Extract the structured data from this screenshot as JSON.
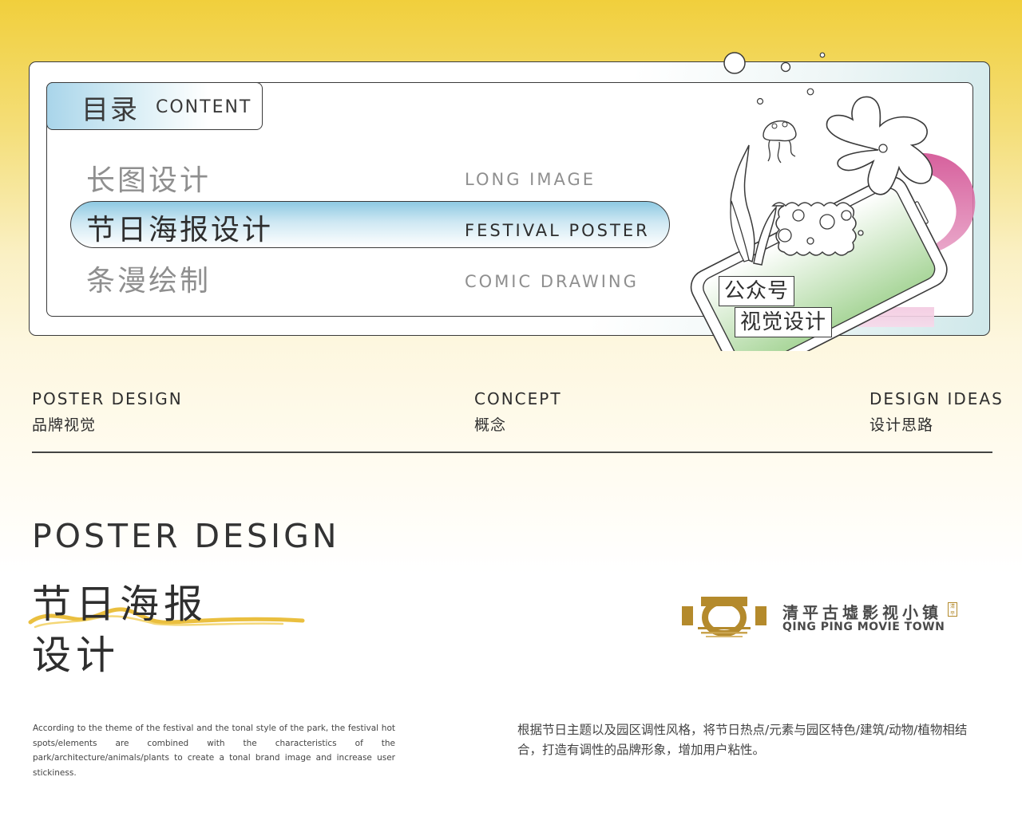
{
  "menu": {
    "tab_cn": "目录",
    "tab_en": "CONTENT",
    "items": [
      {
        "cn": "长图设计",
        "en": "LONG  IMAGE",
        "active": false
      },
      {
        "cn": "节日海报设计",
        "en": "FESTIVAL  POSTER",
        "active": true
      },
      {
        "cn": "条漫绘制",
        "en": "COMIC  DRAWING",
        "active": false
      }
    ],
    "illustration_tags": [
      "公众号",
      "视觉设计"
    ]
  },
  "columns": [
    {
      "en": "POSTER DESIGN",
      "cn": "品牌视觉"
    },
    {
      "en": "CONCEPT",
      "cn": "概念"
    },
    {
      "en": "DESIGN IDEAS",
      "cn": "设计思路"
    }
  ],
  "section": {
    "title_en": "POSTER DESIGN",
    "title_cn_line1": "节日海报",
    "title_cn_line2": "设计",
    "body_en": "According to the theme of the festival and the tonal style of the park, the festival hot spots/elements are combined with the characteristics of the park/architecture/animals/plants to create a tonal brand image and increase user stickiness.",
    "body_cn": "根据节日主题以及园区调性风格，将节日热点/元素与园区特色/建筑/动物/植物相结合，打造有调性的品牌形象，增加用户粘性。"
  },
  "logo": {
    "name_cn": "清平古墟影视小镇",
    "name_en": "QING PING MOVIE TOWN",
    "seal_text": "清平"
  },
  "colors": {
    "top_yellow": "#f1cf3c",
    "highlight_blue": "#8ec9e2",
    "logo_gold": "#b48a2c",
    "brush_yellow": "#e8b82a",
    "pink_ribbon": "#d46aa0",
    "green_screen": "#bfe0b0"
  }
}
